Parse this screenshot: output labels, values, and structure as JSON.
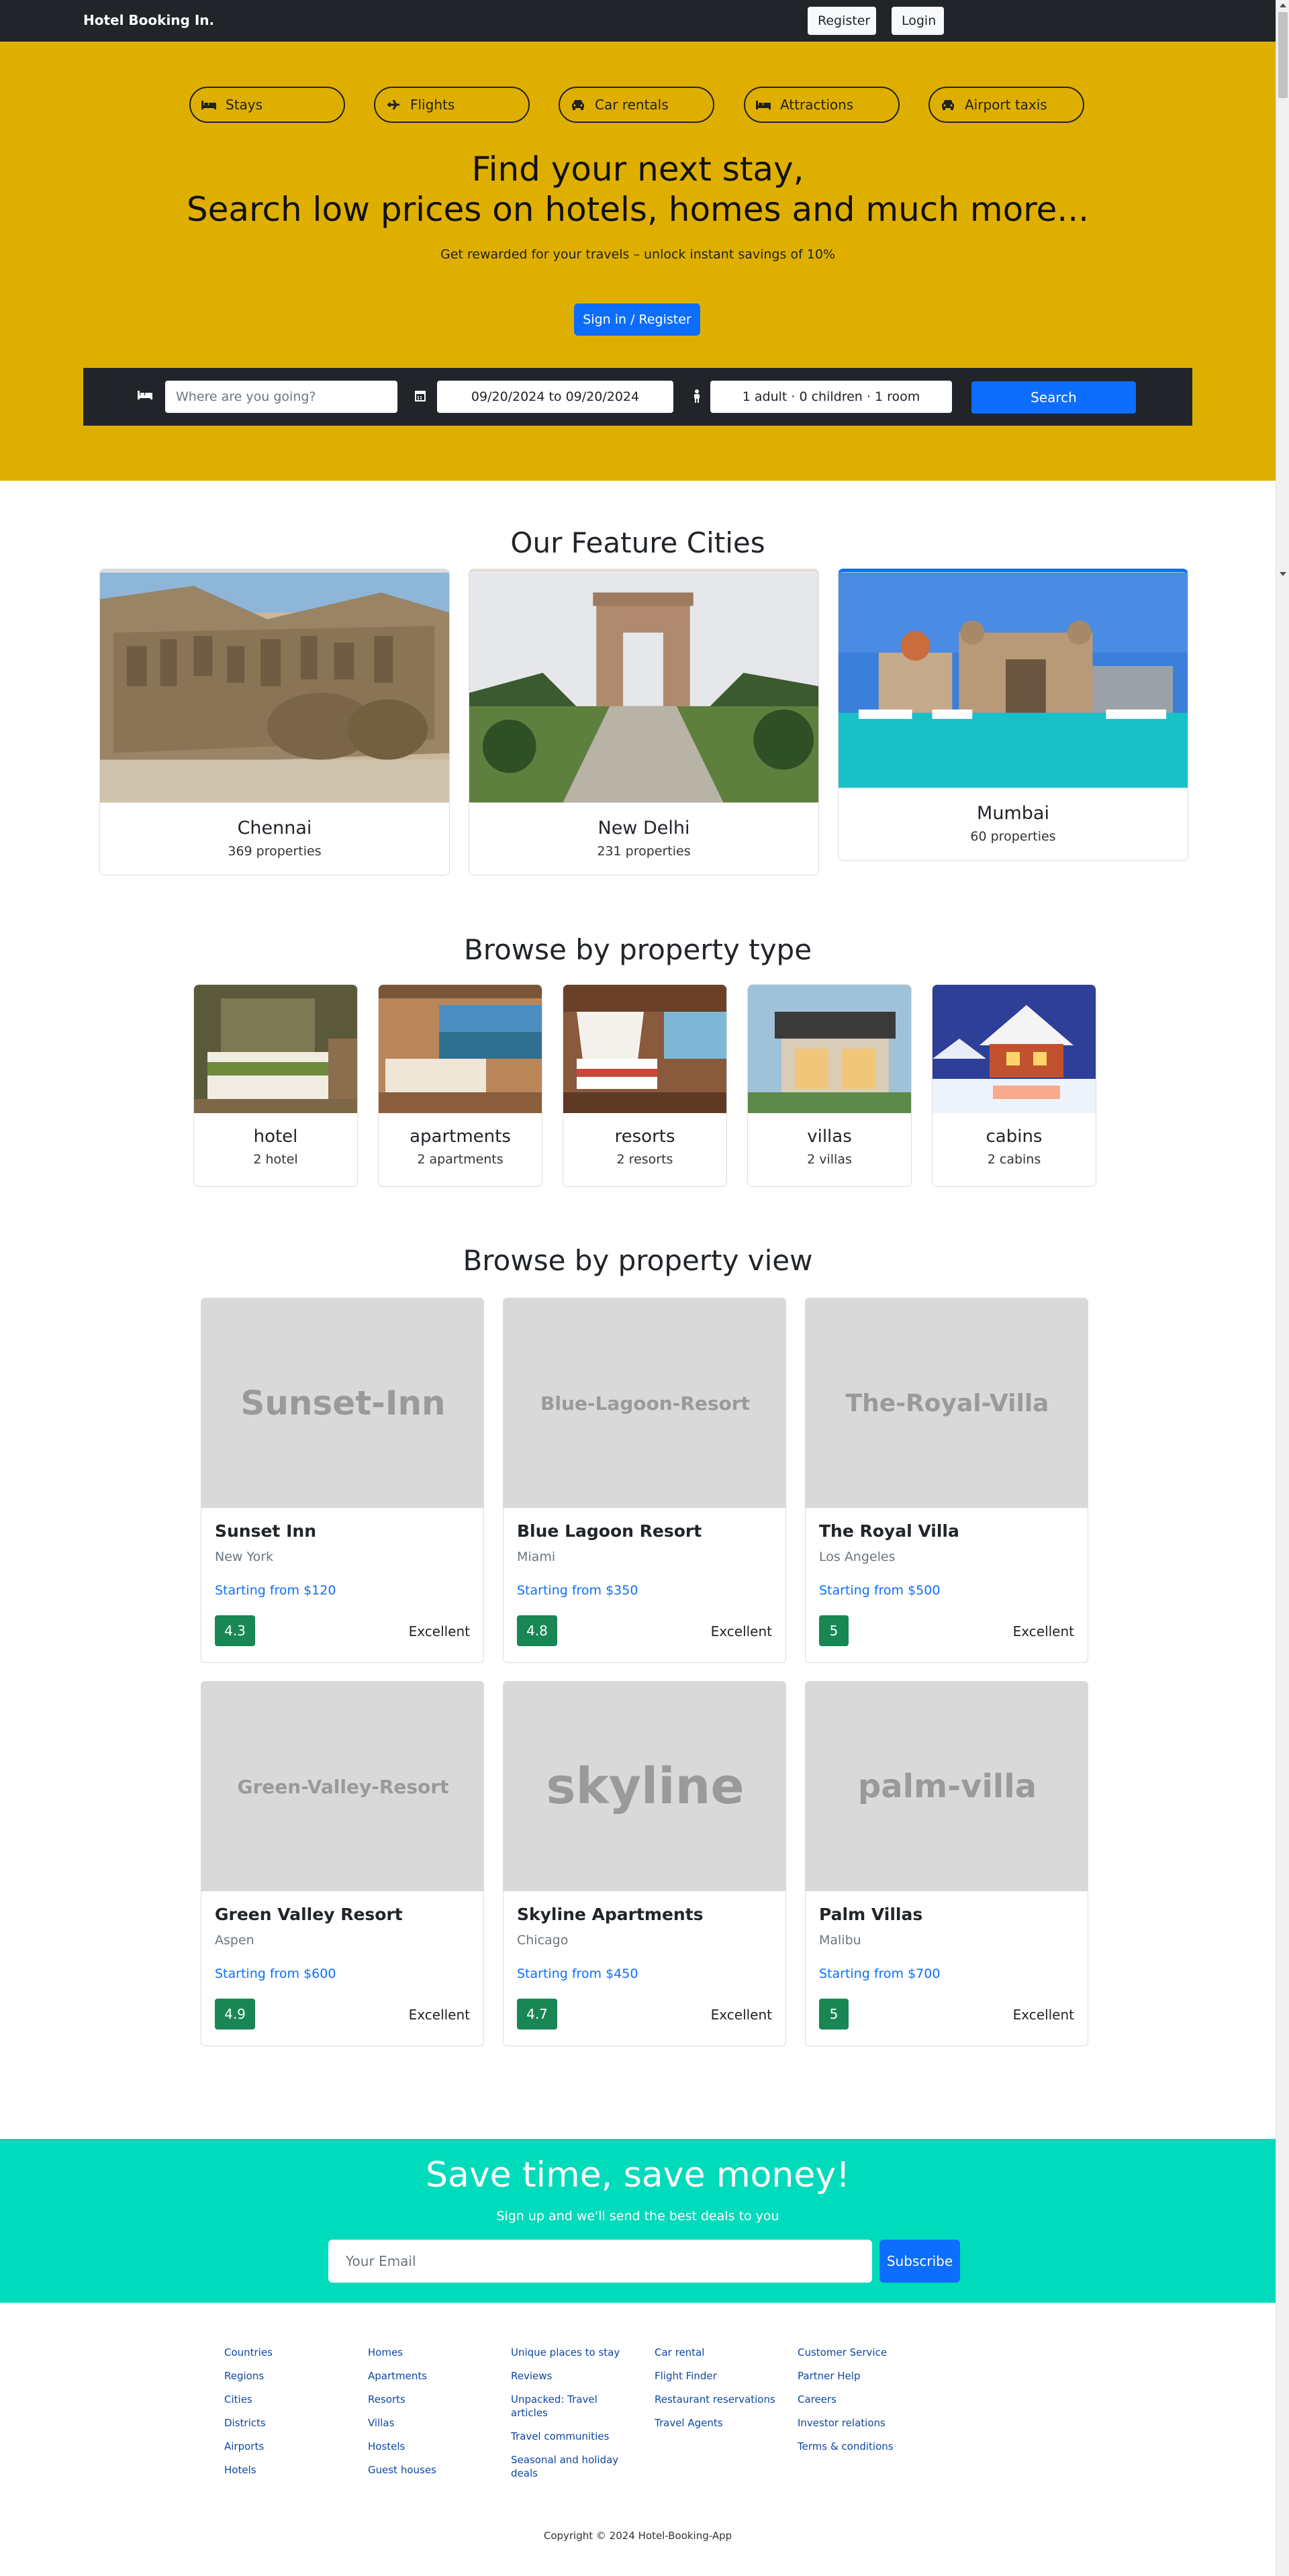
{
  "nav": {
    "brand": "Hotel Booking In.",
    "register": "Register",
    "login": "Login"
  },
  "hero": {
    "tabs": [
      {
        "label": "Stays",
        "icon": "bed-icon"
      },
      {
        "label": "Flights",
        "icon": "plane-icon"
      },
      {
        "label": "Car rentals",
        "icon": "car-icon"
      },
      {
        "label": "Attractions",
        "icon": "bed-icon"
      },
      {
        "label": "Airport taxis",
        "icon": "taxi-icon"
      }
    ],
    "title_line1": "Find your next stay,",
    "title_line2": "Search low prices on hotels, homes and much more...",
    "subtitle": "Get rewarded for your travels – unlock instant savings of 10%",
    "signin_button": "Sign in / Register",
    "accent_color": "#dfaf00"
  },
  "search": {
    "destination_placeholder": "Where are you going?",
    "dates": "09/20/2024 to 09/20/2024",
    "guests": "1 adult · 0 children · 1 room",
    "button": "Search"
  },
  "cities": {
    "title": "Our Feature Cities",
    "items": [
      {
        "name": "Chennai",
        "properties": "369 properties"
      },
      {
        "name": "New Delhi",
        "properties": "231 properties"
      },
      {
        "name": "Mumbai",
        "properties": "60 properties"
      }
    ]
  },
  "property_types": {
    "title": "Browse by property type",
    "items": [
      {
        "name": "hotel",
        "count": "2 hotel"
      },
      {
        "name": "apartments",
        "count": "2 apartments"
      },
      {
        "name": "resorts",
        "count": "2 resorts"
      },
      {
        "name": "villas",
        "count": "2 villas"
      },
      {
        "name": "cabins",
        "count": "2 cabins"
      }
    ]
  },
  "property_views": {
    "title": "Browse by property view",
    "items": [
      {
        "image_text": "Sunset-Inn",
        "name": "Sunset Inn",
        "city": "New York",
        "price": "Starting from $120",
        "rating": "4.3",
        "label": "Excellent"
      },
      {
        "image_text": "Blue-Lagoon-Resort",
        "name": "Blue Lagoon Resort",
        "city": "Miami",
        "price": "Starting from $350",
        "rating": "4.8",
        "label": "Excellent"
      },
      {
        "image_text": "The-Royal-Villa",
        "name": "The Royal Villa",
        "city": "Los Angeles",
        "price": "Starting from $500",
        "rating": "5",
        "label": "Excellent"
      },
      {
        "image_text": "Green-Valley-Resort",
        "name": "Green Valley Resort",
        "city": "Aspen",
        "price": "Starting from $600",
        "rating": "4.9",
        "label": "Excellent"
      },
      {
        "image_text": "skyline",
        "name": "Skyline Apartments",
        "city": "Chicago",
        "price": "Starting from $450",
        "rating": "4.7",
        "label": "Excellent"
      },
      {
        "image_text": "palm-villa",
        "name": "Palm Villas",
        "city": "Malibu",
        "price": "Starting from $700",
        "rating": "5",
        "label": "Excellent"
      }
    ]
  },
  "newsletter": {
    "title": "Save time, save money!",
    "subtitle": "Sign up and we'll send the best deals to you",
    "email_placeholder": "Your Email",
    "button": "Subscribe",
    "color": "#00dbbb"
  },
  "footer": {
    "columns": [
      [
        "Countries",
        "Regions",
        "Cities",
        "Districts",
        "Airports",
        "Hotels"
      ],
      [
        "Homes",
        "Apartments",
        "Resorts",
        "Villas",
        "Hostels",
        "Guest houses"
      ],
      [
        "Unique places to stay",
        "Reviews",
        "Unpacked: Travel articles",
        "Travel communities",
        "Seasonal and holiday deals"
      ],
      [
        "Car rental",
        "Flight Finder",
        "Restaurant reservations",
        "Travel Agents"
      ],
      [
        "Customer Service",
        "Partner Help",
        "Careers",
        "Investor relations",
        "Terms & conditions"
      ]
    ],
    "copyright": "Copyright © 2024 Hotel-Booking-App"
  }
}
